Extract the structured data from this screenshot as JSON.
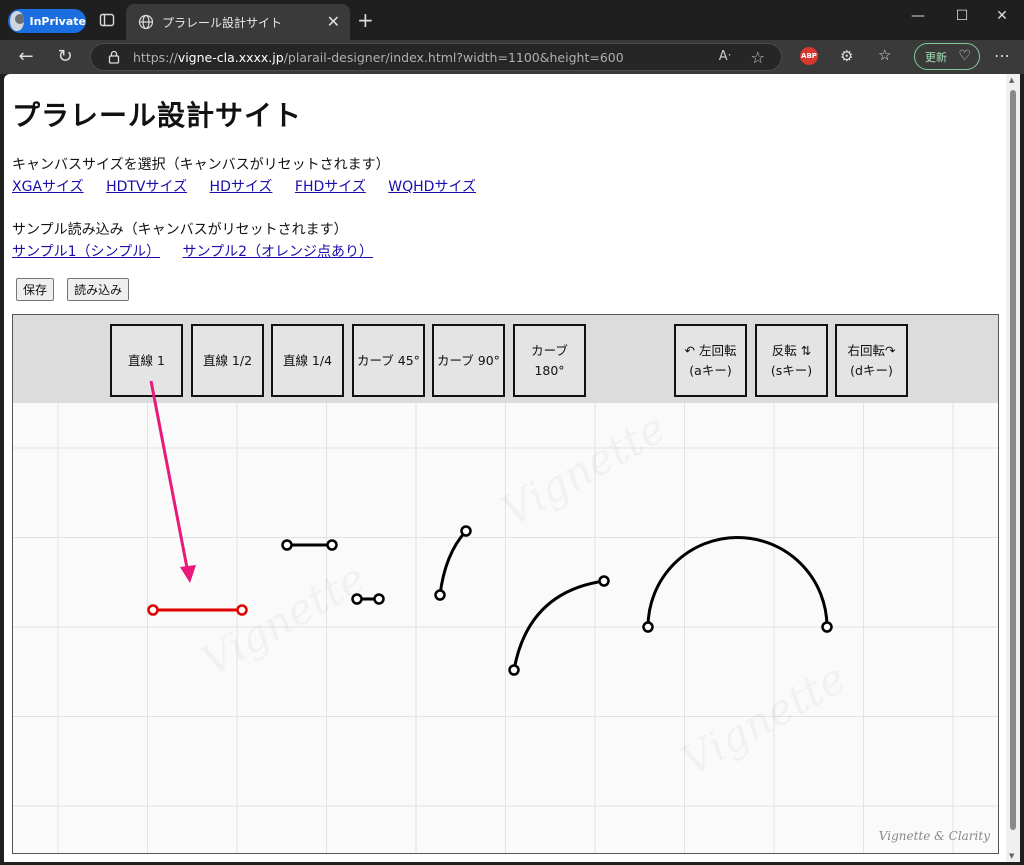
{
  "browser": {
    "inprivate_label": "InPrivate",
    "tab_title": "プラレール設計サイト",
    "url_prefix": "https://",
    "url_host": "vigne-cla.xxxx.jp",
    "url_rest": "/plarail-designer/index.html?width=1100&height=600",
    "update_label": "更新",
    "abp_label": "ABP"
  },
  "page": {
    "title": "プラレール設計サイト",
    "size_label": "キャンバスサイズを選択（キャンバスがリセットされます）",
    "size_links": [
      "XGAサイズ",
      "HDTVサイズ",
      "HDサイズ",
      "FHDサイズ",
      "WQHDサイズ"
    ],
    "sample_label": "サンプル読み込み（キャンバスがリセットされます）",
    "sample_links": [
      "サンプル1（シンプル）",
      "サンプル2（オレンジ点あり）"
    ],
    "save_label": "保存",
    "load_label": "読み込み"
  },
  "toolbar": {
    "parts": [
      "直線 1",
      "直線 1/2",
      "直線 1/4",
      "カーブ 45°",
      "カーブ 90°",
      "カーブ 180°"
    ],
    "rotate_left": {
      "line1": "↶ 左回転",
      "line2": "(aキー)"
    },
    "flip": {
      "line1": "反転 ⇅",
      "line2": "(sキー)"
    },
    "rotate_right": {
      "line1": "右回転↷",
      "line2": "(dキー)"
    }
  },
  "canvas": {
    "logo": "Vignette & Clarity",
    "accent": "#e8197a",
    "selected_color": "#e00000",
    "track_color": "#000000"
  }
}
